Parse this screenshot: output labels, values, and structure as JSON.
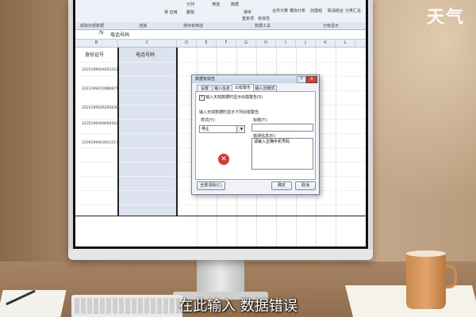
{
  "watermark": "天气",
  "ribbon": {
    "items": [
      "分列",
      "删除",
      "排 应用",
      "筛选",
      "数据",
      "排序",
      "重复项",
      "有效性",
      "合并计算",
      "模拟分析",
      "创建组",
      "取消组合",
      "分类汇总"
    ],
    "groups": [
      "获取外部数据",
      "连接",
      "排序和筛选",
      "数据工具",
      "分级显示"
    ]
  },
  "formula_bar": {
    "fx": "fx",
    "value": "电话号码"
  },
  "sheet": {
    "columns": [
      "B",
      "C",
      "D",
      "E",
      "F",
      "G",
      "H",
      "I",
      "J",
      "K",
      "L"
    ],
    "col_b_header": "身份证号",
    "col_c_header": "电话号码",
    "ids": [
      "2225199004053211",
      "2223199210086871",
      "2224199506295638",
      "2235199309050502",
      "2339199403011217"
    ]
  },
  "dialog": {
    "title": "数据有效性",
    "help": "?",
    "close": "X",
    "tabs": [
      "设置",
      "输入信息",
      "出错警告",
      "输入法模式"
    ],
    "checkbox_label": "输入无效数据时显示出错警告(S)",
    "section_label": "输入无效数据时显示下列出错警告:",
    "style_label": "样式(Y):",
    "style_value": "停止",
    "title_label": "标题(T):",
    "message_label": "错误信息(E):",
    "message_value": "请输入正确手机号码",
    "clear_button": "全部清除(C)",
    "ok_button": "确定",
    "cancel_button": "取消"
  },
  "caption": "在此输入 数据错误"
}
